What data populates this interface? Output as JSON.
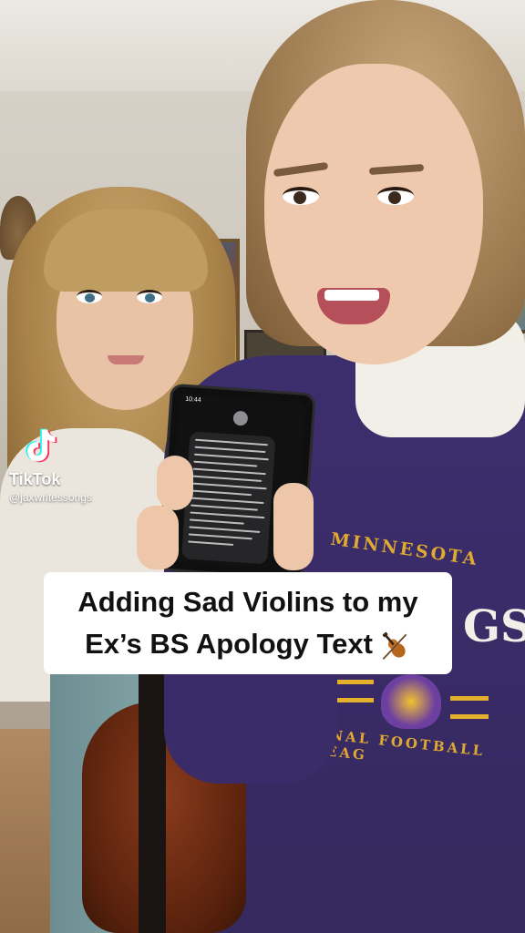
{
  "watermark": {
    "app_name": "TikTok",
    "handle": "@jaxwritessongs",
    "logo_icon": "tiktok-logo-icon"
  },
  "caption": {
    "line1": "Adding Sad Violins to my",
    "line2": "Ex’s BS Apology Text",
    "emoji_icon": "violin-emoji-icon"
  },
  "sweater_print": {
    "top": "MINNESOTA",
    "middle": "GS",
    "bottom": "ONAL FOOTBALL LEAG"
  },
  "phone": {
    "time": "10:44"
  }
}
